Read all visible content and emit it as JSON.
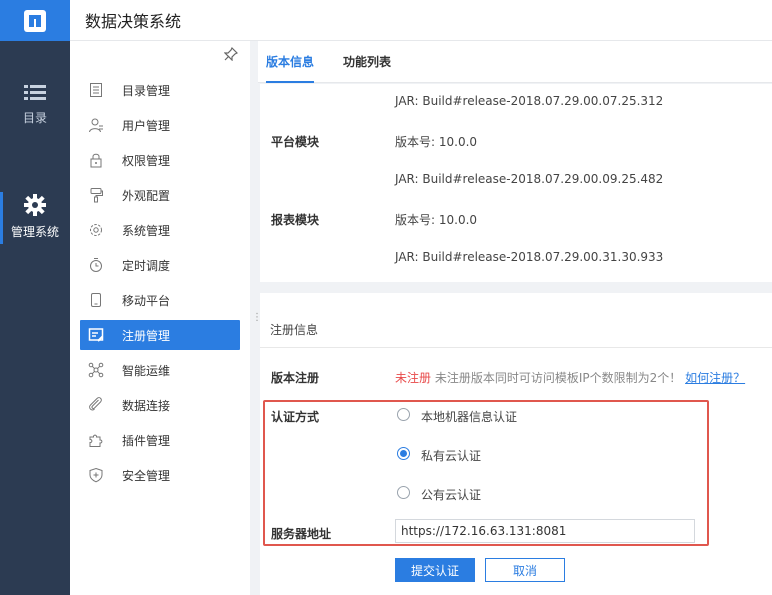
{
  "app": {
    "title": "数据决策系统",
    "accent": "#2b7de1",
    "rail_bg": "#2c3b52"
  },
  "rail": {
    "items": [
      {
        "label": "目录",
        "icon": "list-icon"
      },
      {
        "label": "管理系统",
        "icon": "gear-icon"
      }
    ]
  },
  "sidebar": {
    "items": [
      {
        "label": "目录管理",
        "icon": "directory-icon"
      },
      {
        "label": "用户管理",
        "icon": "user-icon"
      },
      {
        "label": "权限管理",
        "icon": "lock-icon"
      },
      {
        "label": "外观配置",
        "icon": "brush-icon"
      },
      {
        "label": "系统管理",
        "icon": "gear-icon"
      },
      {
        "label": "定时调度",
        "icon": "timer-icon"
      },
      {
        "label": "移动平台",
        "icon": "mobile-icon"
      },
      {
        "label": "注册管理",
        "icon": "register-icon",
        "active": true
      },
      {
        "label": "智能运维",
        "icon": "network-icon"
      },
      {
        "label": "数据连接",
        "icon": "link-icon"
      },
      {
        "label": "插件管理",
        "icon": "puzzle-icon"
      },
      {
        "label": "安全管理",
        "icon": "shield-icon"
      }
    ]
  },
  "tabs": [
    {
      "label": "版本信息",
      "active": true
    },
    {
      "label": "功能列表"
    }
  ],
  "version": {
    "jar_top": "JAR: Build#release-2018.07.29.00.07.25.312",
    "platform_label": "平台模块",
    "platform_version": "版本号: 10.0.0",
    "platform_jar": "JAR: Build#release-2018.07.29.00.09.25.482",
    "report_label": "报表模块",
    "report_version": "版本号: 10.0.0",
    "report_jar": "JAR: Build#release-2018.07.29.00.31.30.933"
  },
  "registration": {
    "section_title": "注册信息",
    "version_reg_label": "版本注册",
    "status": "未注册",
    "hint": "未注册版本同时可访问模板IP个数限制为2个！",
    "how_link": "如何注册？",
    "auth_label": "认证方式",
    "auth_options": [
      {
        "label": "本地机器信息认证",
        "selected": false
      },
      {
        "label": "私有云认证",
        "selected": true
      },
      {
        "label": "公有云认证",
        "selected": false
      }
    ],
    "server_label": "服务器地址",
    "server_value": "https://172.16.63.131:8081",
    "submit_label": "提交认证",
    "cancel_label": "取消"
  }
}
